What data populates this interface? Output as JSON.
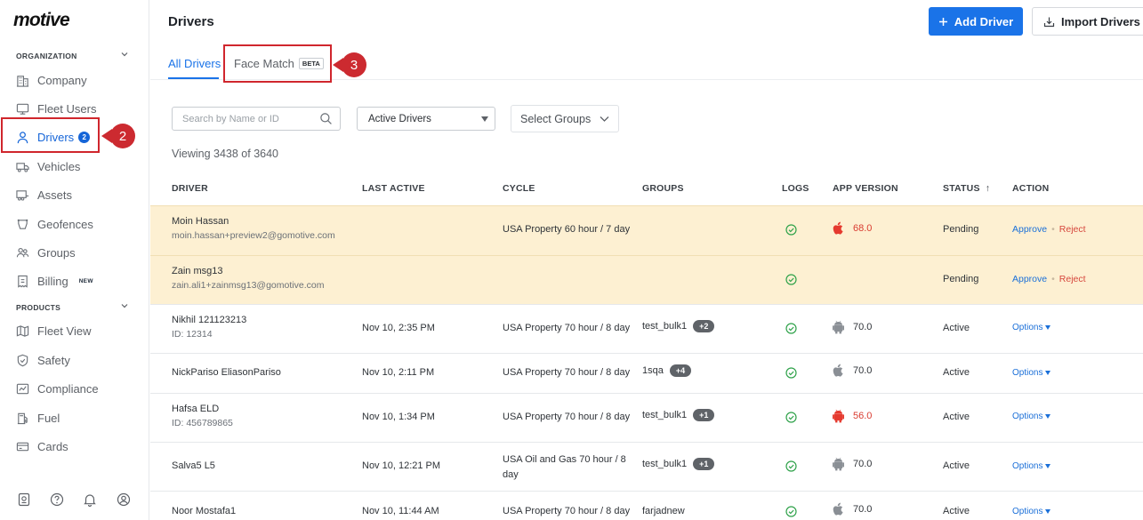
{
  "brand": {
    "logo": "motive"
  },
  "sidebar": {
    "org_label": "ORGANIZATION",
    "products_label": "PRODUCTS",
    "org_items": [
      {
        "label": "Company",
        "icon": "building-icon"
      },
      {
        "label": "Fleet Users",
        "icon": "monitor-icon"
      },
      {
        "label": "Drivers",
        "icon": "person-icon",
        "badge": "2"
      },
      {
        "label": "Vehicles",
        "icon": "truck-icon"
      },
      {
        "label": "Assets",
        "icon": "trailer-icon"
      },
      {
        "label": "Geofences",
        "icon": "geofence-icon"
      },
      {
        "label": "Groups",
        "icon": "groups-icon"
      },
      {
        "label": "Billing",
        "icon": "billing-icon",
        "tag": "NEW"
      }
    ],
    "product_items": [
      {
        "label": "Fleet View",
        "icon": "map-icon"
      },
      {
        "label": "Safety",
        "icon": "shield-icon"
      },
      {
        "label": "Compliance",
        "icon": "compliance-icon"
      },
      {
        "label": "Fuel",
        "icon": "fuel-icon"
      },
      {
        "label": "Cards",
        "icon": "card-icon"
      }
    ],
    "bottom_icons": [
      "logbook-icon",
      "help-icon",
      "bell-icon",
      "profile-icon"
    ]
  },
  "callouts": {
    "drivers": "2",
    "face_match": "3"
  },
  "header": {
    "title": "Drivers",
    "add_label": "Add Driver",
    "import_label": "Import Drivers"
  },
  "tabs": {
    "all": "All Drivers",
    "face": "Face Match",
    "beta": "BETA"
  },
  "filters": {
    "search_placeholder": "Search by Name or ID",
    "status_value": "Active Drivers",
    "groups_placeholder": "Select Groups"
  },
  "viewing": "Viewing 3438 of 3640",
  "columns": {
    "driver": "DRIVER",
    "last_active": "LAST ACTIVE",
    "cycle": "CYCLE",
    "groups": "GROUPS",
    "logs": "LOGS",
    "app_version": "APP VERSION",
    "status": "STATUS",
    "sort_arrow": "↑",
    "action": "ACTION"
  },
  "actions": {
    "approve": "Approve",
    "reject": "Reject",
    "options": "Options"
  },
  "rows": [
    {
      "name": "Moin Hassan",
      "sub": "moin.hassan+preview2@gomotive.com",
      "last_active": "",
      "cycle": "USA Property 60 hour / 7 day",
      "group": "",
      "extra": "",
      "platform": "apple",
      "version": "68.0",
      "version_red": true,
      "status": "Pending",
      "pending": true
    },
    {
      "name": "Zain msg13",
      "sub": "zain.ali1+zainmsg13@gomotive.com",
      "last_active": "",
      "cycle": "",
      "group": "",
      "extra": "",
      "platform": "",
      "version": "",
      "version_red": false,
      "status": "Pending",
      "pending": true
    },
    {
      "name": "Nikhil 121123213",
      "sub": "ID: 12314",
      "last_active": "Nov 10, 2:35 PM",
      "cycle": "USA Property 70 hour / 8 day",
      "group": "test_bulk1",
      "extra": "+2",
      "platform": "android",
      "version": "70.0",
      "version_red": false,
      "status": "Active",
      "pending": false
    },
    {
      "name": "NickPariso EliasonPariso",
      "sub": "",
      "last_active": "Nov 10, 2:11 PM",
      "cycle": "USA Property 70 hour / 8 day",
      "group": "1sqa",
      "extra": "+4",
      "platform": "apple",
      "version": "70.0",
      "version_red": false,
      "status": "Active",
      "pending": false
    },
    {
      "name": "Hafsa ELD",
      "sub": "ID: 456789865",
      "last_active": "Nov 10, 1:34 PM",
      "cycle": "USA Property 70 hour / 8 day",
      "group": "test_bulk1",
      "extra": "+1",
      "platform": "android",
      "version": "56.0",
      "version_red": true,
      "status": "Active",
      "pending": false
    },
    {
      "name": "Salva5 L5",
      "sub": "",
      "last_active": "Nov 10, 12:21 PM",
      "cycle": "USA Oil and Gas 70 hour / 8 day",
      "group": "test_bulk1",
      "extra": "+1",
      "platform": "android",
      "version": "70.0",
      "version_red": false,
      "status": "Active",
      "pending": false
    },
    {
      "name": "Noor Mostafa1",
      "sub": "",
      "last_active": "Nov 10, 11:44 AM",
      "cycle": "USA Property 70 hour / 8 day",
      "group": "farjadnew",
      "extra": "",
      "platform": "apple",
      "version": "70.0",
      "version_red": false,
      "status": "Active",
      "pending": false
    }
  ]
}
